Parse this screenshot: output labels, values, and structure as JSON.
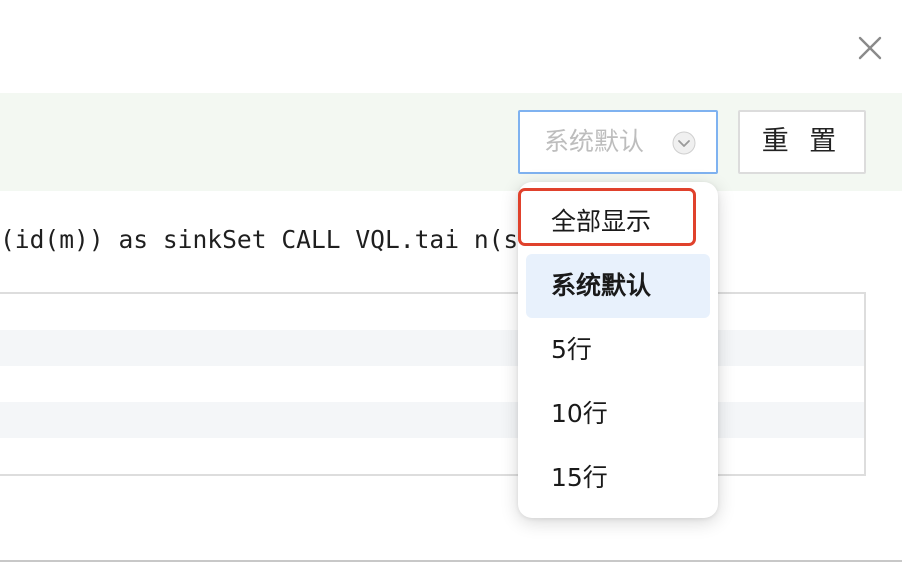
{
  "dialog": {
    "close_icon": "close-icon"
  },
  "toolbar": {
    "select": {
      "value": "系统默认",
      "arrow_icon": "chevron-down-icon"
    },
    "reset_label": "重 置"
  },
  "query": {
    "text": "(id(m)) as sinkSet CALL VQL.tai                         n(sourc…"
  },
  "dropdown": {
    "options": [
      {
        "label": "全部显示",
        "selected": false
      },
      {
        "label": "系统默认",
        "selected": true
      },
      {
        "label": "5行",
        "selected": false
      },
      {
        "label": "10行",
        "selected": false
      },
      {
        "label": "15行",
        "selected": false
      }
    ]
  },
  "colors": {
    "toolbar_bg": "#f3f8f2",
    "select_border": "#7fb2f0",
    "selected_option_bg": "#e8f1fc",
    "highlight": "#e0412c"
  }
}
